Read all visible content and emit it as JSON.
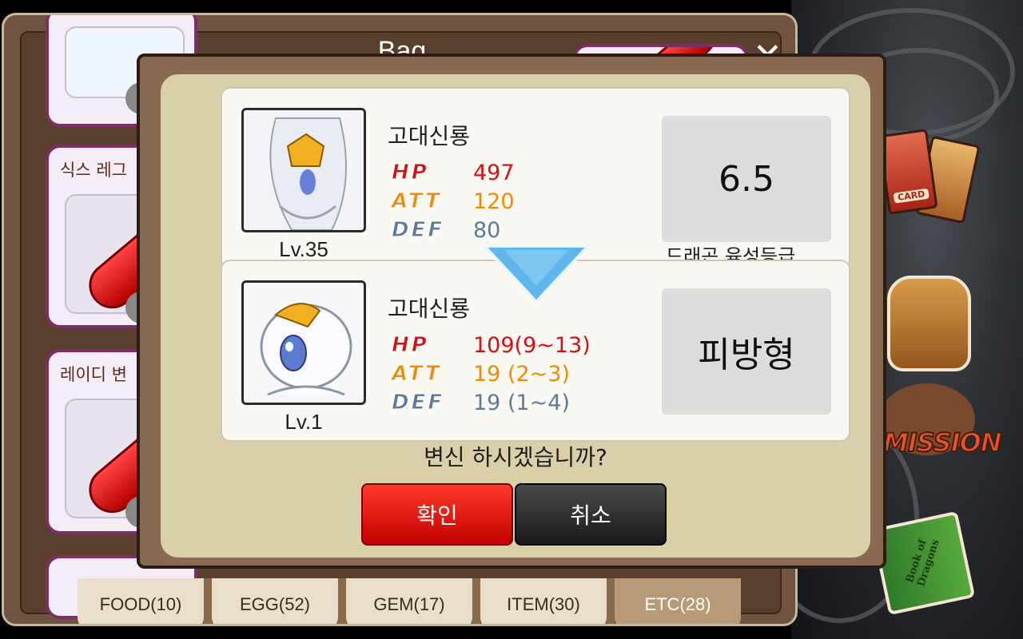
{
  "bag": {
    "title": "Bag",
    "close_label": "✕",
    "items": [
      {
        "name": ""
      },
      {
        "name": "식스 레그"
      },
      {
        "name": "레이디 변"
      },
      {
        "name": ""
      }
    ]
  },
  "tabs": [
    {
      "label": "FOOD(10)",
      "active": false
    },
    {
      "label": "EGG(52)",
      "active": false
    },
    {
      "label": "GEM(17)",
      "active": false
    },
    {
      "label": "ITEM(30)",
      "active": false
    },
    {
      "label": "ETC(28)",
      "active": true
    }
  ],
  "side_menu": {
    "card_label": "CARD",
    "mission_label": "MISSION",
    "book_label": "Book of Dragons"
  },
  "dialog": {
    "current": {
      "level": "Lv.35",
      "name": "고대신룡",
      "hp_label": "HP",
      "hp": "497",
      "att_label": "ATT",
      "att": "120",
      "def_label": "DEF",
      "def": "80",
      "grade": "6.5",
      "grade_caption": "드래곤 육성등급"
    },
    "result": {
      "level": "Lv.1",
      "name": "고대신룡",
      "hp_label": "HP",
      "hp": "109(9~13)",
      "att_label": "ATT",
      "att": "19 (2~3)",
      "def_label": "DEF",
      "def": "19 (1~4)",
      "type": "피방형"
    },
    "question": "변신 하시겠습니까?",
    "confirm_label": "확인",
    "cancel_label": "취소"
  },
  "colors": {
    "hp": "#d41010",
    "att": "#f08a00",
    "def": "#5d7b99",
    "confirm": "#e01a10",
    "cancel": "#2a2a2a"
  }
}
